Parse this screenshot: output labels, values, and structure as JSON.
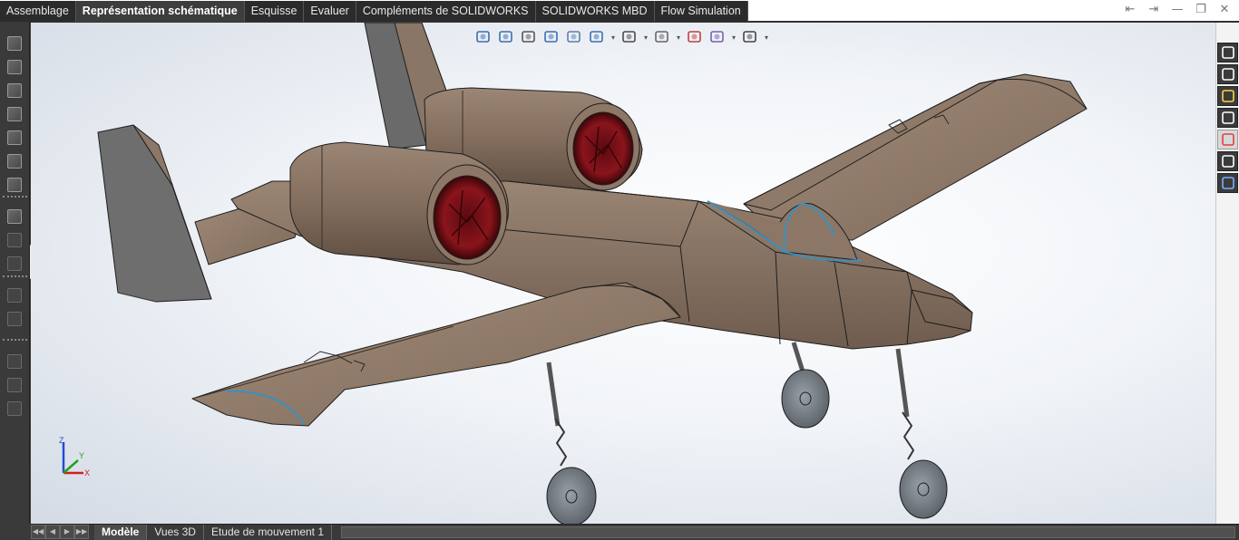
{
  "tabs": [
    {
      "label": "Assemblage",
      "active": false
    },
    {
      "label": "Représentation schématique",
      "active": true
    },
    {
      "label": "Esquisse",
      "active": false
    },
    {
      "label": "Evaluer",
      "active": false
    },
    {
      "label": "Compléments de SOLIDWORKS",
      "active": false
    },
    {
      "label": "SOLIDWORKS MBD",
      "active": false
    },
    {
      "label": "Flow Simulation",
      "active": false
    }
  ],
  "window_controls": [
    {
      "name": "collapse-left-icon",
      "glyph": "⇤"
    },
    {
      "name": "collapse-right-icon",
      "glyph": "⇥"
    },
    {
      "name": "minimize-icon",
      "glyph": "—"
    },
    {
      "name": "restore-icon",
      "glyph": "❐"
    },
    {
      "name": "close-icon",
      "glyph": "✕"
    }
  ],
  "hud_tools": [
    {
      "name": "zoom-to-fit-icon",
      "dropdown": false
    },
    {
      "name": "zoom-to-area-icon",
      "dropdown": false
    },
    {
      "name": "previous-view-icon",
      "dropdown": false
    },
    {
      "name": "section-view-icon",
      "dropdown": false
    },
    {
      "name": "dynamic-annotation-icon",
      "dropdown": false
    },
    {
      "name": "view-orientation-icon",
      "dropdown": true
    },
    {
      "name": "display-style-icon",
      "dropdown": true
    },
    {
      "name": "hide-show-items-icon",
      "dropdown": true
    },
    {
      "name": "edit-appearance-icon",
      "dropdown": false
    },
    {
      "name": "apply-scene-icon",
      "dropdown": true
    },
    {
      "name": "view-settings-icon",
      "dropdown": true
    }
  ],
  "task_pane": [
    {
      "name": "solidworks-resources-icon",
      "active": false
    },
    {
      "name": "design-library-icon",
      "active": false
    },
    {
      "name": "file-explorer-icon",
      "active": false
    },
    {
      "name": "view-palette-icon",
      "active": false
    },
    {
      "name": "appearances-scenes-icon",
      "active": true
    },
    {
      "name": "custom-properties-icon",
      "active": false
    },
    {
      "name": "solidworks-forum-icon",
      "active": false
    }
  ],
  "triad": {
    "x_label": "X",
    "y_label": "Y",
    "z_label": "Z"
  },
  "bottom_nav": [
    "◀◀",
    "◀",
    "▶",
    "▶▶"
  ],
  "bottom_tabs": [
    {
      "label": "Modèle",
      "active": true
    },
    {
      "label": "Vues 3D",
      "active": false
    },
    {
      "label": "Etude de mouvement 1",
      "active": false
    }
  ],
  "colors": {
    "body": "#8a7564",
    "engine_red": "#7a1218",
    "edge": "#1e1e1e",
    "sketch_blue": "#3a8fc0",
    "tail_grey": "#5e5e5e"
  }
}
